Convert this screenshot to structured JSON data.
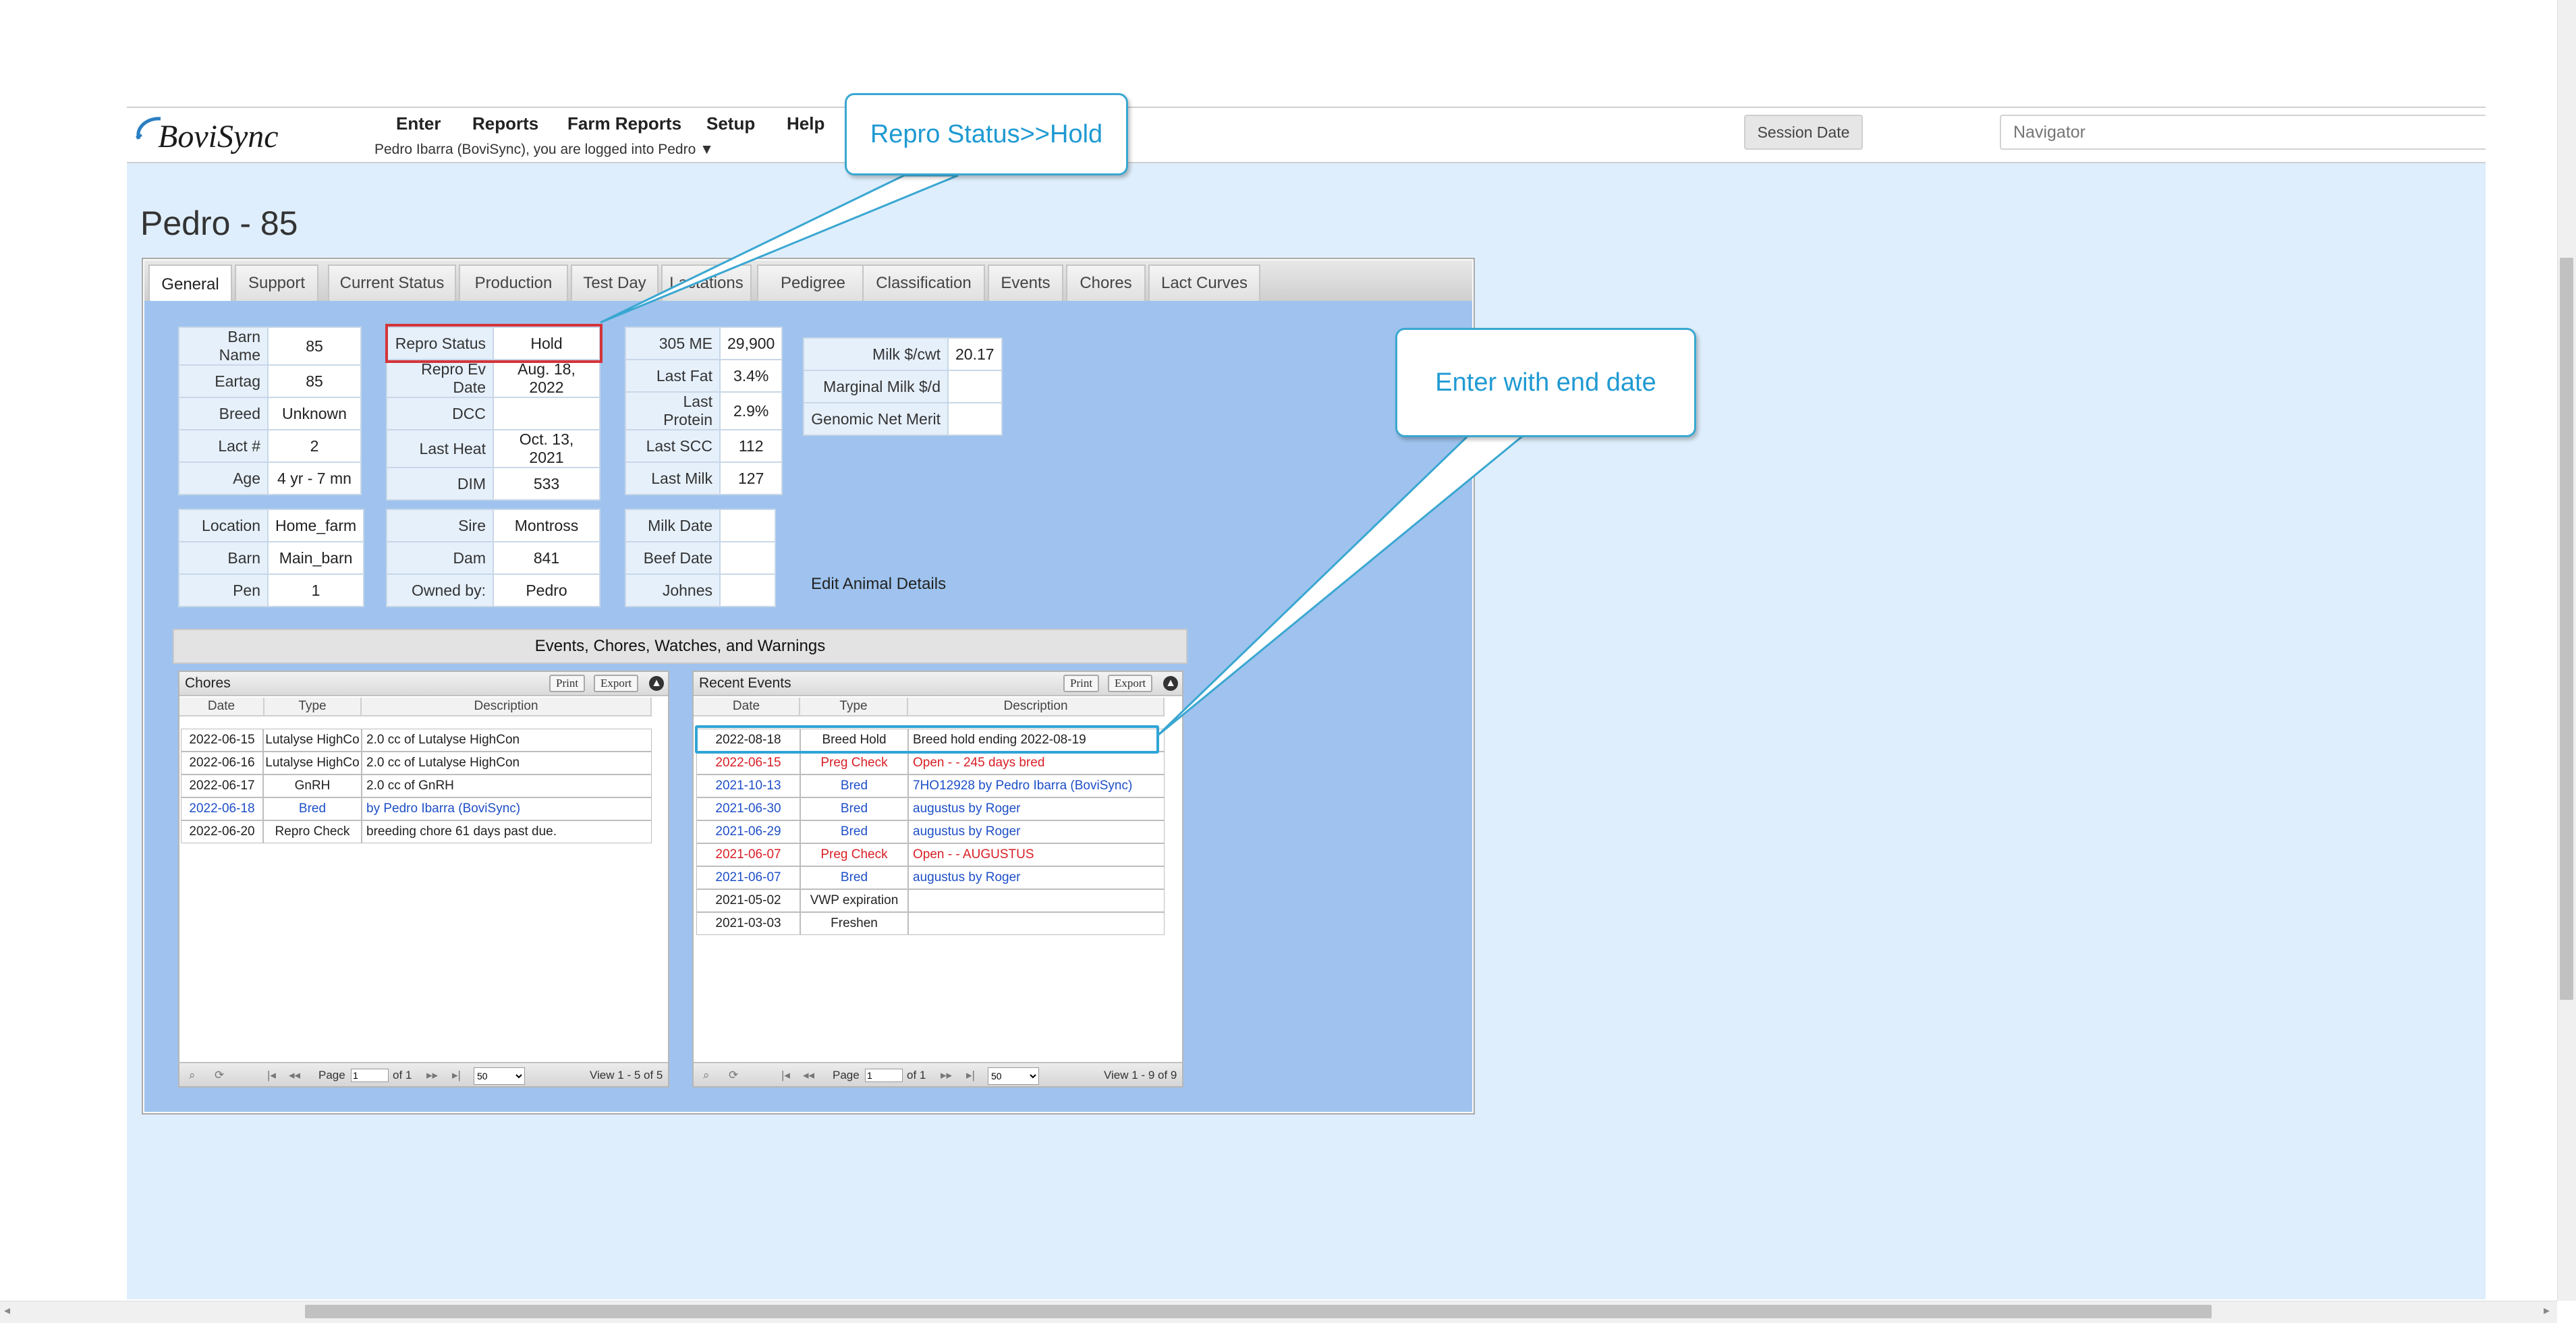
{
  "header": {
    "logo_text": "BoviSync",
    "nav": [
      "Enter",
      "Reports",
      "Farm Reports",
      "Setup",
      "Help"
    ],
    "login_prefix": "Pedro Ibarra (BoviSync), you are logged into ",
    "login_farm": "Pedro",
    "login_caret": "▼",
    "session_date_label": "Session Date",
    "navigator_placeholder": "Navigator"
  },
  "page": {
    "title": "Pedro - 85"
  },
  "tabs": [
    "General",
    "Support",
    "Current Status",
    "Production",
    "Test Day",
    "Lactations",
    "Pedigree",
    "Classification",
    "Events",
    "Chores",
    "Lact Curves"
  ],
  "active_tab": "General",
  "animal": {
    "table1": [
      {
        "label": "Barn Name",
        "value": "85"
      },
      {
        "label": "Eartag",
        "value": "85"
      },
      {
        "label": "Breed",
        "value": "Unknown"
      },
      {
        "label": "Lact #",
        "value": "2"
      },
      {
        "label": "Age",
        "value": "4 yr - 7 mn"
      }
    ],
    "table2": [
      {
        "label": "Repro Status",
        "value": "Hold"
      },
      {
        "label": "Repro Ev Date",
        "value": "Aug. 18, 2022"
      },
      {
        "label": "DCC",
        "value": ""
      },
      {
        "label": "Last Heat",
        "value": "Oct. 13, 2021"
      },
      {
        "label": "DIM",
        "value": "533"
      }
    ],
    "table3": [
      {
        "label": "305 ME",
        "value": "29,900"
      },
      {
        "label": "Last Fat",
        "value": "3.4%"
      },
      {
        "label": "Last Protein",
        "value": "2.9%"
      },
      {
        "label": "Last SCC",
        "value": "112"
      },
      {
        "label": "Last Milk",
        "value": "127"
      }
    ],
    "table4": [
      {
        "label": "Milk $/cwt",
        "value": "20.17"
      },
      {
        "label": "Marginal Milk $/d",
        "value": ""
      },
      {
        "label": "Genomic Net Merit",
        "value": ""
      }
    ],
    "table5": [
      {
        "label": "Location",
        "value": "Home_farm"
      },
      {
        "label": "Barn",
        "value": "Main_barn"
      },
      {
        "label": "Pen",
        "value": "1"
      }
    ],
    "table6": [
      {
        "label": "Sire",
        "value": "Montross"
      },
      {
        "label": "Dam",
        "value": "841"
      },
      {
        "label": "Owned by:",
        "value": "Pedro"
      }
    ],
    "table7": [
      {
        "label": "Milk Date",
        "value": ""
      },
      {
        "label": "Beef Date",
        "value": ""
      },
      {
        "label": "Johnes",
        "value": ""
      }
    ],
    "edit_link": "Edit Animal Details"
  },
  "events_section_title": "Events, Chores, Watches, and Warnings",
  "chores": {
    "title": "Chores",
    "print": "Print",
    "export": "Export",
    "columns": [
      "Date",
      "Type",
      "Description"
    ],
    "rows": [
      {
        "date": "2022-06-15",
        "type": "Lutalyse HighCo",
        "description": "2.0 cc of Lutalyse HighCon",
        "color": "#222222"
      },
      {
        "date": "2022-06-16",
        "type": "Lutalyse HighCo",
        "description": "2.0 cc of Lutalyse HighCon",
        "color": "#222222"
      },
      {
        "date": "2022-06-17",
        "type": "GnRH",
        "description": "2.0 cc of GnRH",
        "color": "#222222"
      },
      {
        "date": "2022-06-18",
        "type": "Bred",
        "description": " by Pedro Ibarra (BoviSync)",
        "color": "#1e4fc8"
      },
      {
        "date": "2022-06-20",
        "type": "Repro Check",
        "description": "breeding chore 61 days past due.",
        "color": "#222222"
      }
    ],
    "page_label": "Page",
    "page_value": "1",
    "of_label": "of 1",
    "page_size": "50",
    "view_text": "View 1 - 5 of 5"
  },
  "recent_events": {
    "title": "Recent Events",
    "print": "Print",
    "export": "Export",
    "columns": [
      "Date",
      "Type",
      "Description"
    ],
    "rows": [
      {
        "date": "2022-08-18",
        "type": "Breed Hold",
        "description": "Breed hold ending 2022-08-19",
        "color": "#222222"
      },
      {
        "date": "2022-06-15",
        "type": "Preg Check",
        "description": "Open -  - 245 days bred",
        "color": "#d81f26"
      },
      {
        "date": "2021-10-13",
        "type": "Bred",
        "description": "7HO12928  by Pedro Ibarra (BoviSync)",
        "color": "#1e4fc8"
      },
      {
        "date": "2021-06-30",
        "type": "Bred",
        "description": "augustus  by Roger",
        "color": "#1e4fc8"
      },
      {
        "date": "2021-06-29",
        "type": "Bred",
        "description": "augustus  by Roger",
        "color": "#1e4fc8"
      },
      {
        "date": "2021-06-07",
        "type": "Preg Check",
        "description": "Open -  - AUGUSTUS",
        "color": "#d81f26"
      },
      {
        "date": "2021-06-07",
        "type": "Bred",
        "description": "augustus  by Roger",
        "color": "#1e4fc8"
      },
      {
        "date": "2021-05-02",
        "type": "VWP expiration",
        "description": "",
        "color": "#222222"
      },
      {
        "date": "2021-03-03",
        "type": "Freshen",
        "description": "",
        "color": "#222222"
      }
    ],
    "page_label": "Page",
    "page_value": "1",
    "of_label": "of 1",
    "page_size": "50",
    "view_text": "View 1 - 9 of 9"
  },
  "callouts": {
    "repro": "Repro Status>>Hold",
    "enter": "Enter with end date"
  },
  "colors": {
    "accent": "#1f9ad2",
    "highlight_red": "#d3343a",
    "content_bg": "#dfeefc",
    "tab_body_bg": "#9fc3ee"
  }
}
